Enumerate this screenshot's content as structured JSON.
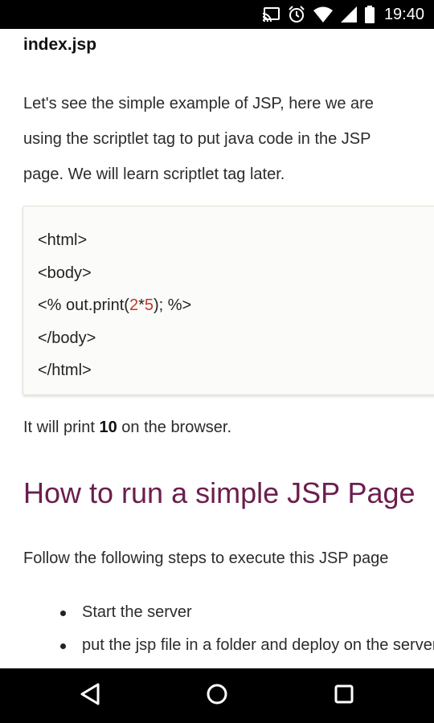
{
  "status_bar": {
    "time": "19:40",
    "icons": [
      "cast-icon",
      "alarm-icon",
      "wifi-icon",
      "signal-icon",
      "battery-icon"
    ]
  },
  "article": {
    "file_name": "index.jsp",
    "intro_lines": [
      "Let's see the simple example of JSP, here we are",
      "using the scriptlet tag to put java code in the JSP",
      "page. We will learn scriptlet tag later."
    ],
    "code": {
      "line1": "<html>",
      "line2": "<body>",
      "line3_prefix": "<% out.print(",
      "line3_num1": "2",
      "line3_op": "*",
      "line3_num2": "5",
      "line3_suffix": "); %>",
      "line4": "</body>",
      "line5": "</html>",
      "number_color": "#c0392b"
    },
    "print_line": {
      "prefix": "It will print ",
      "value": "10",
      "suffix": " on the browser."
    },
    "section_heading": "How to run a simple JSP Page",
    "steps_intro": "Follow the following steps to execute this JSP page",
    "steps": [
      "Start the server",
      "put the jsp file in a folder and deploy on the server"
    ]
  },
  "nav_bar": {
    "buttons": [
      "back-icon",
      "home-icon",
      "recents-icon"
    ]
  },
  "colors": {
    "heading": "#6b1e4d",
    "code_background": "#fbfbf9",
    "bars": "#000000"
  }
}
